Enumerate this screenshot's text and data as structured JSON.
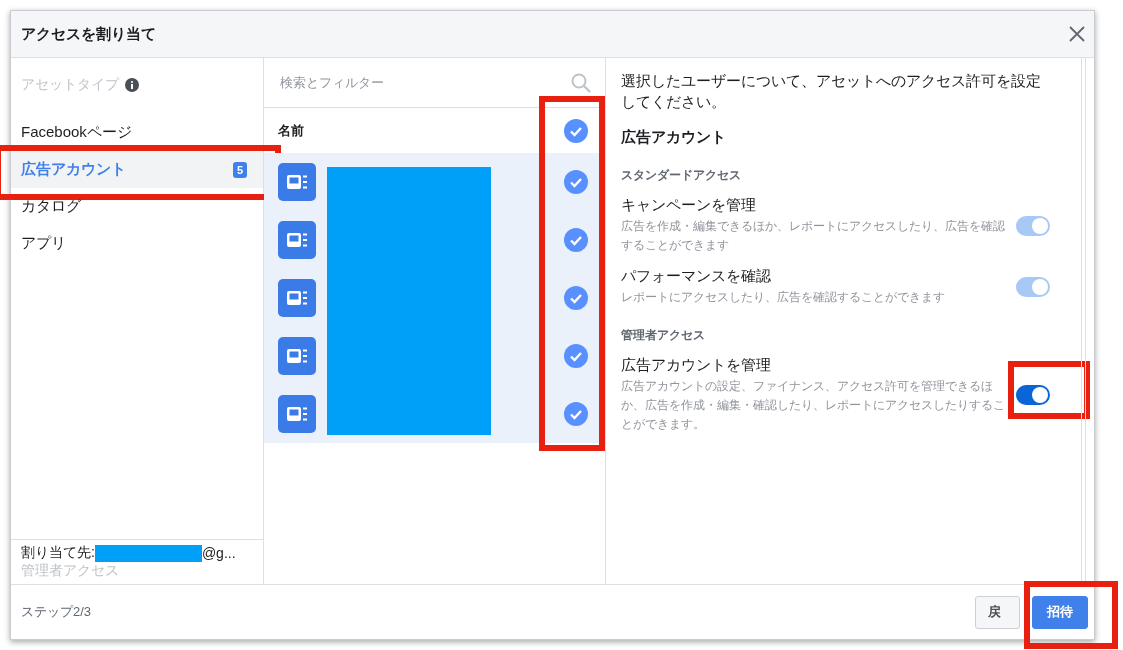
{
  "dialog": {
    "title": "アクセスを割り当て"
  },
  "sidebar": {
    "heading": "アセットタイプ",
    "items": [
      {
        "label": "Facebookページ",
        "selected": false
      },
      {
        "label": "広告アカウント",
        "selected": true,
        "badge": "5",
        "highlighted": true
      },
      {
        "label": "カタログ",
        "selected": false
      },
      {
        "label": "アプリ",
        "selected": false
      }
    ],
    "assignee": {
      "label": "割り当て先:",
      "suffix": "@g...",
      "role": "管理者アクセス"
    }
  },
  "assets": {
    "search_placeholder": "検索とフィルター",
    "column": "名前",
    "select_all_checked": true,
    "checks_highlighted": true,
    "rows": [
      {
        "checked": true
      },
      {
        "checked": true
      },
      {
        "checked": true
      },
      {
        "checked": true
      },
      {
        "checked": true
      }
    ]
  },
  "permissions": {
    "intro": "選択したユーザーについて、アセットへのアクセス許可を設定してください。",
    "title": "広告アカウント",
    "groups": [
      {
        "heading": "スタンダードアクセス",
        "items": [
          {
            "name": "キャンペーンを管理",
            "description": "広告を作成・編集できるほか、レポートにアクセスしたり、広告を確認することができます",
            "on": true,
            "disabled": true
          },
          {
            "name": "パフォーマンスを確認",
            "description": "レポートにアクセスしたり、広告を確認することができます",
            "on": true,
            "disabled": true
          }
        ]
      },
      {
        "heading": "管理者アクセス",
        "items": [
          {
            "name": "広告アカウントを管理",
            "description": "広告アカウントの設定、ファイナンス、アクセス許可を管理できるほか、広告を作成・編集・確認したり、レポートにアクセスしたりすることができます。",
            "on": true,
            "disabled": false,
            "highlighted": true
          }
        ]
      }
    ]
  },
  "footer": {
    "step": "ステップ2/3",
    "buttons": [
      {
        "kind": "secondary",
        "label": "戻"
      },
      {
        "kind": "primary",
        "label": "招待",
        "highlighted": true
      }
    ]
  }
}
